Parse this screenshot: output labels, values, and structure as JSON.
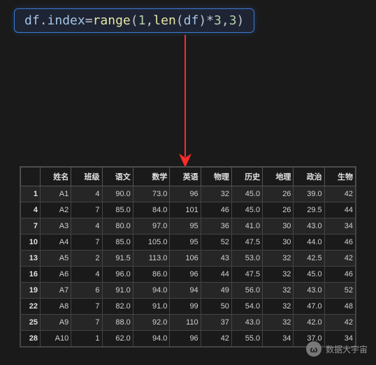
{
  "code": {
    "raw": "df.index=range(1,len(df)*3,3)",
    "parts": {
      "df1": "df",
      "dot1": ".",
      "index": "index",
      "eq": "=",
      "range": "range",
      "lp1": "(",
      "n1": "1",
      "c1": ",",
      "len": "len",
      "lp2": "(",
      "df2": "df",
      "rp2": ")",
      "mul": "*",
      "n3a": "3",
      "c2": ",",
      "n3b": "3",
      "rp1": ")"
    }
  },
  "chart_data": {
    "type": "table",
    "columns": [
      "",
      "姓名",
      "班级",
      "语文",
      "数学",
      "英语",
      "物理",
      "历史",
      "地理",
      "政治",
      "生物"
    ],
    "rows": [
      [
        "1",
        "A1",
        "4",
        "90.0",
        "73.0",
        "96",
        "32",
        "45.0",
        "26",
        "39.0",
        "42"
      ],
      [
        "4",
        "A2",
        "7",
        "85.0",
        "84.0",
        "101",
        "46",
        "45.0",
        "26",
        "29.5",
        "44"
      ],
      [
        "7",
        "A3",
        "4",
        "80.0",
        "97.0",
        "95",
        "36",
        "41.0",
        "30",
        "43.0",
        "34"
      ],
      [
        "10",
        "A4",
        "7",
        "85.0",
        "105.0",
        "95",
        "52",
        "47.5",
        "30",
        "44.0",
        "46"
      ],
      [
        "13",
        "A5",
        "2",
        "91.5",
        "113.0",
        "106",
        "43",
        "53.0",
        "32",
        "42.5",
        "42"
      ],
      [
        "16",
        "A6",
        "4",
        "96.0",
        "86.0",
        "96",
        "44",
        "47.5",
        "32",
        "45.0",
        "46"
      ],
      [
        "19",
        "A7",
        "6",
        "91.0",
        "94.0",
        "94",
        "49",
        "56.0",
        "32",
        "43.0",
        "52"
      ],
      [
        "22",
        "A8",
        "7",
        "82.0",
        "91.0",
        "99",
        "50",
        "54.0",
        "32",
        "47.0",
        "48"
      ],
      [
        "25",
        "A9",
        "7",
        "88.0",
        "92.0",
        "110",
        "37",
        "43.0",
        "32",
        "42.0",
        "42"
      ],
      [
        "28",
        "A10",
        "1",
        "62.0",
        "94.0",
        "96",
        "42",
        "55.0",
        "34",
        "37.0",
        "34"
      ]
    ]
  },
  "watermark": {
    "glyph": "ω",
    "text": "数据大宇宙"
  }
}
